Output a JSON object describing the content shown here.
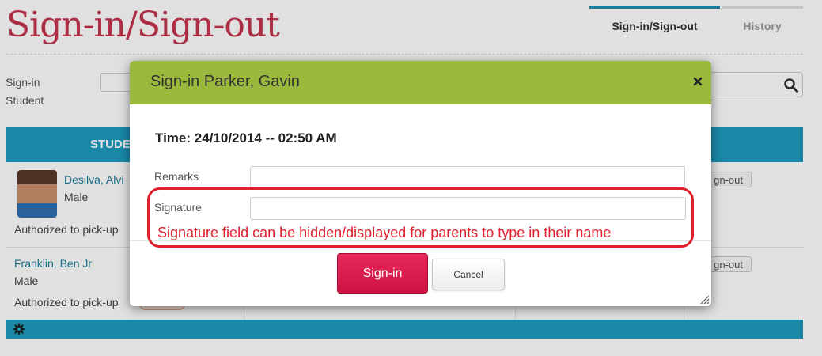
{
  "page": {
    "title": "Sign-in/Sign-out",
    "tabs": [
      {
        "label": "Sign-in/Sign-out",
        "active": true
      },
      {
        "label": "History",
        "active": false
      }
    ],
    "signin_label_line1": "Sign-in",
    "signin_label_line2": "Student",
    "table_header": "STUDE",
    "students": [
      {
        "name": "Desilva, Alvi",
        "gender": "Male",
        "authorized": "Authorized to pick-up",
        "action": "gn-out"
      },
      {
        "name": "Franklin, Ben Jr",
        "gender": "Male",
        "authorized": "Authorized to pick-up",
        "action": "gn-out"
      }
    ]
  },
  "modal": {
    "title": "Sign-in Parker, Gavin",
    "time_label": "Time:",
    "time_value": "24/10/2014 -- 02:50 AM",
    "remarks_label": "Remarks",
    "remarks_value": "",
    "signature_label": "Signature",
    "signature_value": "",
    "signin_button": "Sign-in",
    "cancel_button": "Cancel"
  },
  "annotation": {
    "text": "Signature field can be hidden/displayed for parents to type in their name"
  },
  "colors": {
    "title_red": "#c5344f",
    "table_blue": "#1e9bc0",
    "modal_header_green": "#9ab93c",
    "signin_button": "#d91b4c",
    "annotation_red": "#e0202c"
  },
  "icons": [
    "search-icon",
    "close-icon",
    "gear-icon",
    "resize-grip-icon"
  ]
}
